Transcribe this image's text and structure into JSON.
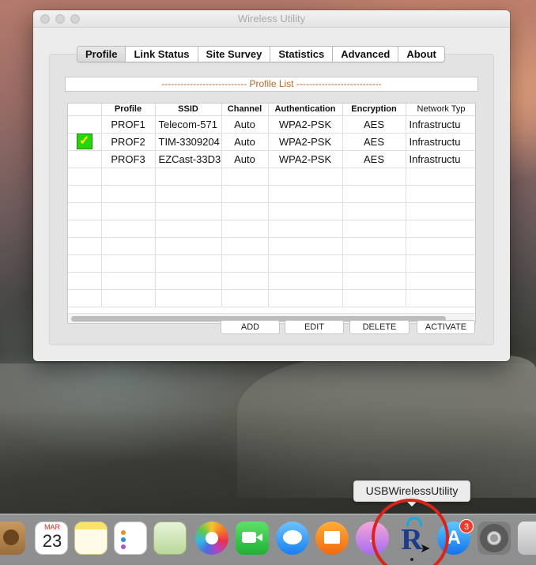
{
  "window": {
    "title": "Wireless Utility"
  },
  "tabs": [
    "Profile",
    "Link Status",
    "Site Survey",
    "Statistics",
    "Advanced",
    "About"
  ],
  "profile_list_label": "---------------------------  Profile List  ---------------------------",
  "table": {
    "headers": [
      "",
      "Profile",
      "SSID",
      "Channel",
      "Authentication",
      "Encryption",
      "Network Typ"
    ],
    "rows": [
      {
        "profile": "PROF1",
        "ssid": "Telecom-571",
        "channel": "Auto",
        "auth": "WPA2-PSK",
        "enc": "AES",
        "net": "Infrastructu",
        "checked": false
      },
      {
        "profile": "PROF2",
        "ssid": "TIM-3309204",
        "channel": "Auto",
        "auth": "WPA2-PSK",
        "enc": "AES",
        "net": "Infrastructu",
        "checked": true
      },
      {
        "profile": "PROF3",
        "ssid": "EZCast-33D3",
        "channel": "Auto",
        "auth": "WPA2-PSK",
        "enc": "AES",
        "net": "Infrastructu",
        "checked": false
      }
    ],
    "check_glyph": "✓"
  },
  "buttons": {
    "add": "ADD",
    "edit": "EDIT",
    "delete": "DELETE",
    "activate": "ACTIVATE"
  },
  "tooltip": "USBWirelessUtility",
  "dock": {
    "calendar_month": "MAR",
    "calendar_day": "23",
    "app_store_badge": "3",
    "usb_icon_letter": "R"
  }
}
